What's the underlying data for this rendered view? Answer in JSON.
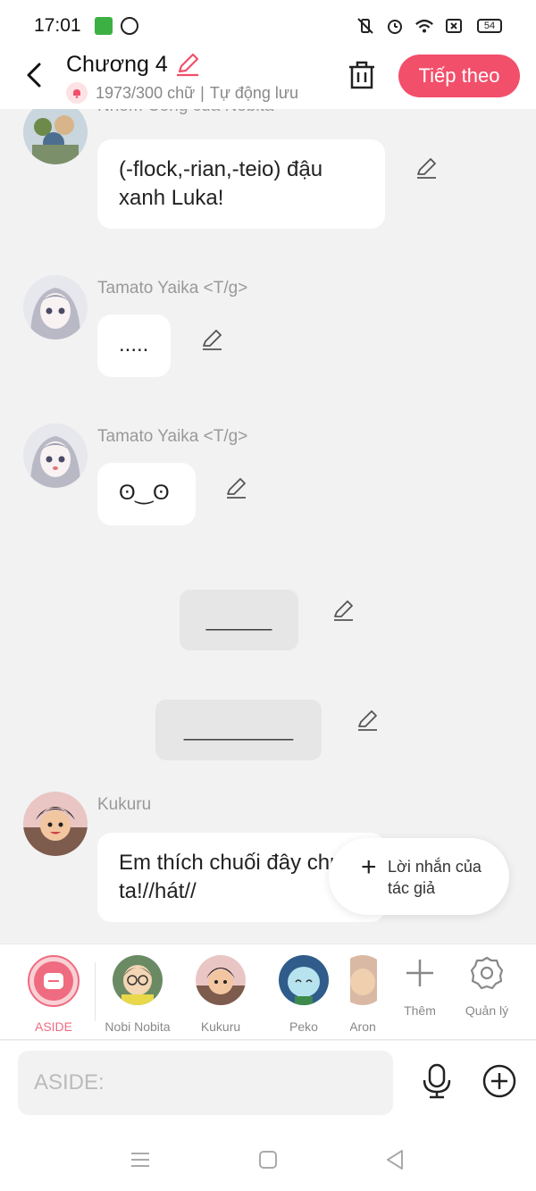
{
  "status_bar": {
    "time": "17:01",
    "battery": "54"
  },
  "header": {
    "title": "Chương 4",
    "word_count": "1973/300 chữ",
    "separator": "|",
    "autosave": "Tự động lưu",
    "next_label": "Tiếp theo"
  },
  "messages": [
    {
      "sender": "Nhóm Công của Nobita",
      "text": "(-flock,-rian,-teio) đậu xanh Luka!"
    },
    {
      "sender": "Tamato Yaika <T/g>",
      "text": "....."
    },
    {
      "sender": "Tamato Yaika <T/g>",
      "text": "ʘ‿ʘ"
    },
    {
      "text": "______"
    },
    {
      "text": "__________"
    },
    {
      "sender": "Kukuru",
      "text": "Em thích chuối đây chuối ta!//hát//"
    }
  ],
  "fab": {
    "label": "Lời nhắn của tác giả"
  },
  "characters": [
    {
      "name": "ASIDE"
    },
    {
      "name": "Nobi Nobita"
    },
    {
      "name": "Kukuru"
    },
    {
      "name": "Peko"
    },
    {
      "name": "Aron"
    }
  ],
  "tools": {
    "add_label": "Thêm",
    "manage_label": "Quản lý"
  },
  "input": {
    "placeholder": "ASIDE:"
  },
  "colors": {
    "accent": "#f24f6b",
    "aside": "#ef6b7f",
    "background": "#f2f2f2"
  }
}
